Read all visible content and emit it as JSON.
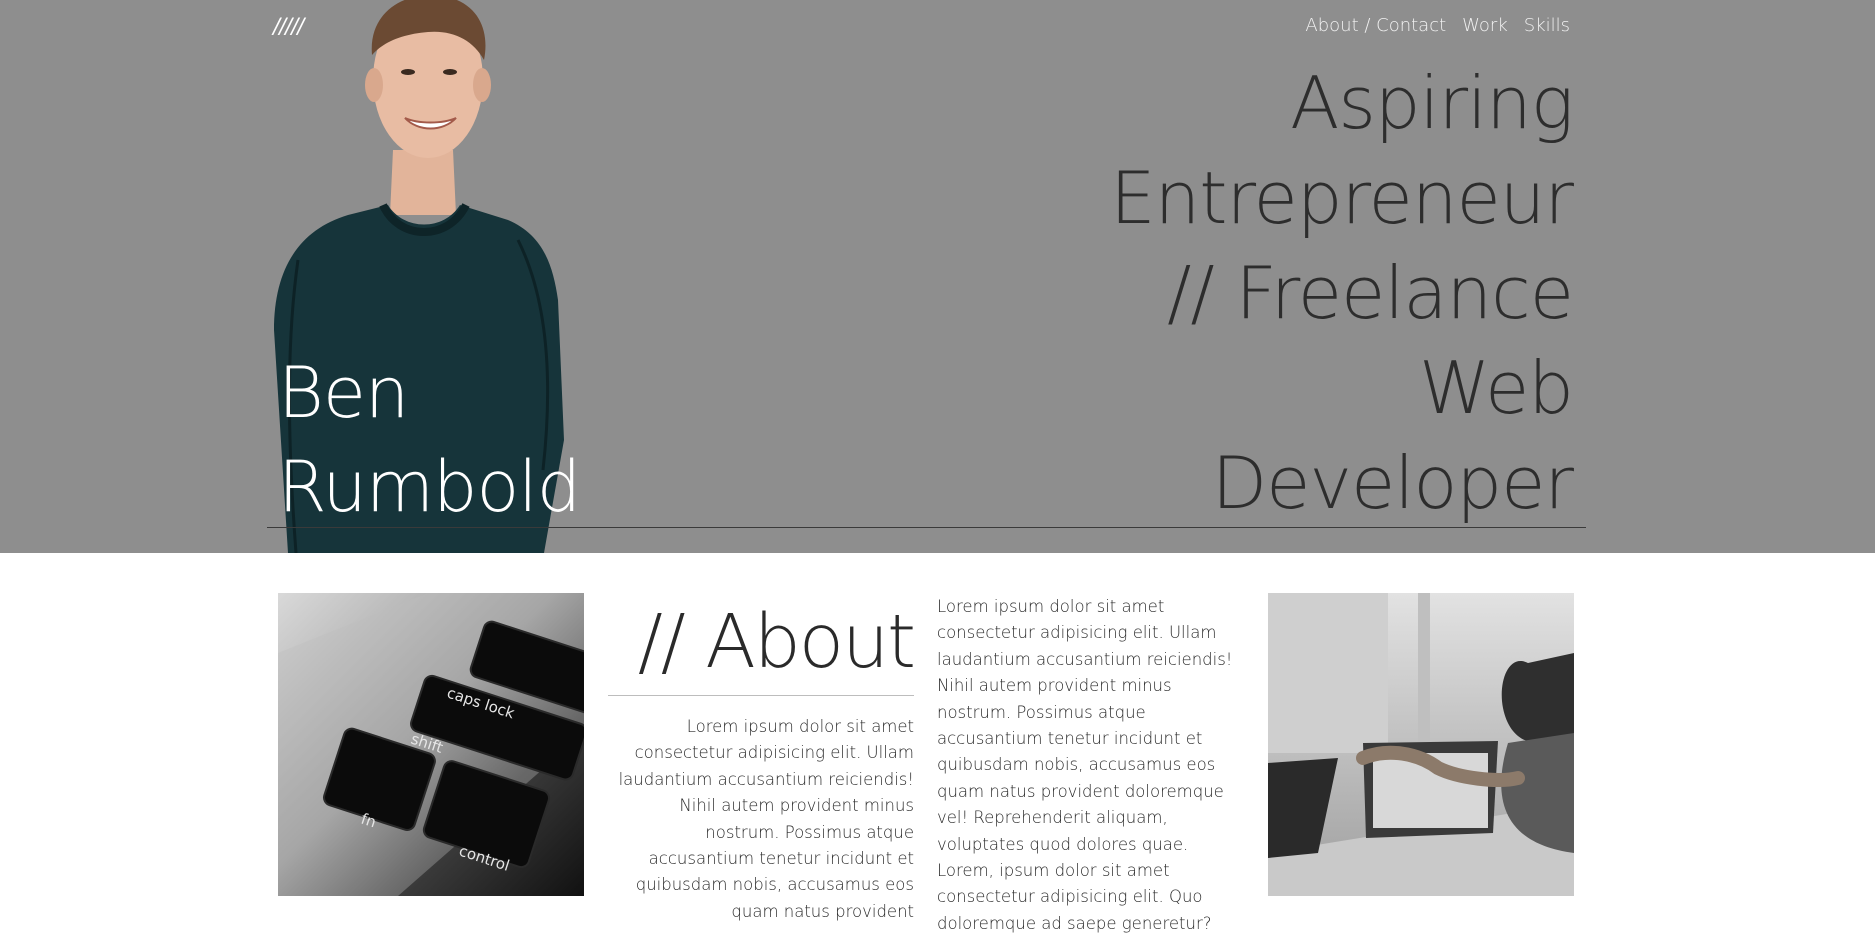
{
  "header": {
    "logo": "/////",
    "nav": [
      {
        "label": "About / Contact"
      },
      {
        "label": "Work"
      },
      {
        "label": "Skills"
      }
    ]
  },
  "hero": {
    "name_first": "Ben",
    "name_last": "Rumbold",
    "tagline": [
      "Aspiring",
      "Entrepreneur",
      "// Freelance",
      "Web",
      "Developer"
    ]
  },
  "about": {
    "heading": "// About",
    "text_right": "Lorem ipsum dolor sit amet consectetur adipisicing elit. Ullam laudantium accusantium reiciendis! Nihil autem provident minus nostrum. Possimus atque accusantium tenetur incidunt et quibusdam nobis, accusamus eos quam natus provident",
    "text_left": "Lorem ipsum dolor sit amet consectetur adipisicing elit. Ullam laudantium accusantium reiciendis! Nihil autem provident minus nostrum. Possimus atque accusantium tenetur incidunt et quibusdam nobis, accusamus eos quam natus provident doloremque vel! Reprehenderit aliquam, voluptates quod dolores quae. Lorem, ipsum dolor sit amet consectetur adipisicing elit. Quo doloremque ad saepe generetur?"
  },
  "images": {
    "keyboard_keys": [
      "caps lock",
      "shift",
      "fn",
      "control"
    ]
  },
  "colors": {
    "hero_bg": "#8e8e8e",
    "sweater": "#16343a",
    "text_dark": "#2d2d2d"
  }
}
